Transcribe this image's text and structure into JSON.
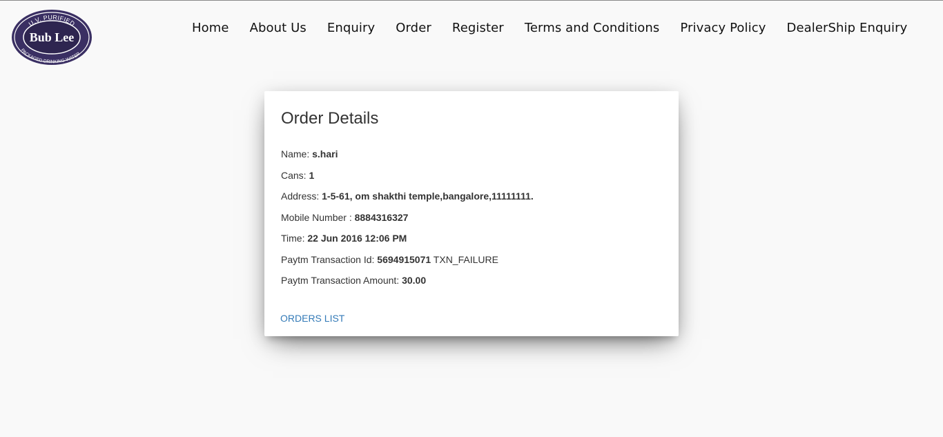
{
  "logo": {
    "top_text": "U.V. PURIFIED",
    "brand": "Bub Lee",
    "bottom_text": "PACKAGED DRINKING WATER",
    "color": "#3a2f63"
  },
  "nav": {
    "items": [
      {
        "label": "Home"
      },
      {
        "label": "About Us"
      },
      {
        "label": "Enquiry"
      },
      {
        "label": "Order"
      },
      {
        "label": "Register"
      },
      {
        "label": "Terms and Conditions"
      },
      {
        "label": "Privacy Policy"
      },
      {
        "label": "DealerShip Enquiry"
      }
    ]
  },
  "order": {
    "title": "Order Details",
    "name_label": "Name: ",
    "name": "s.hari",
    "cans_label": "Cans: ",
    "cans": "1",
    "address_label": "Address: ",
    "address": "1-5-61, om shakthi temple,bangalore,11111111.",
    "mobile_label": "Mobile Number : ",
    "mobile": "8884316327",
    "time_label": "Time: ",
    "time": "22 Jun 2016 12:06 PM",
    "txn_id_label": "Paytm Transaction Id: ",
    "txn_id": "5694915071",
    "txn_status": " TXN_FAILURE",
    "txn_amount_label": "Paytm Transaction Amount: ",
    "txn_amount": "30.00",
    "orders_list_link": "ORDERS LIST"
  }
}
